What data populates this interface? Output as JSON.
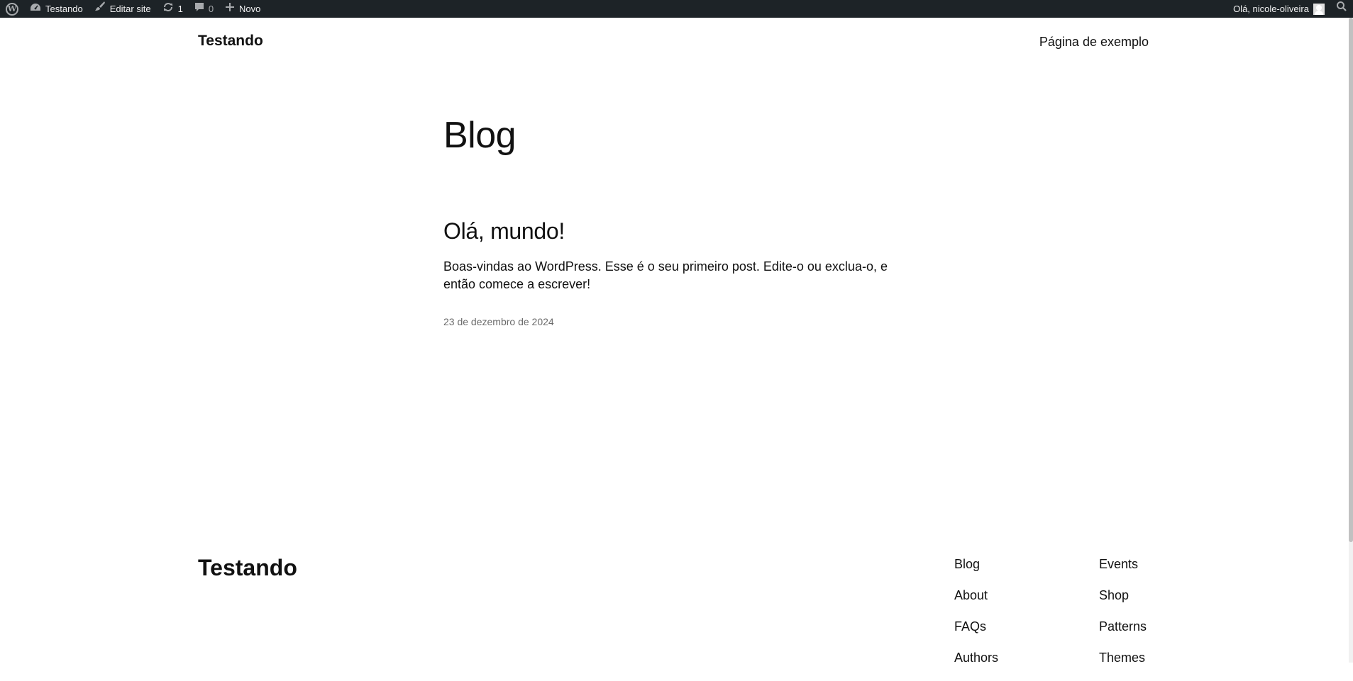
{
  "admin_bar": {
    "site_name": "Testando",
    "edit_site": "Editar site",
    "updates_count": "1",
    "comments_count": "0",
    "new_label": "Novo",
    "greeting": "Olá, nicole-oliveira",
    "icons": {
      "logo": "wordpress-logo-icon",
      "site": "dashboard-icon",
      "edit": "brush-icon",
      "updates": "refresh-icon",
      "comments": "comment-icon",
      "new": "plus-icon",
      "search": "search-icon"
    },
    "background": "#1d2327"
  },
  "header": {
    "site_title": "Testando",
    "nav_link": "Página de exemplo"
  },
  "main": {
    "heading": "Blog",
    "posts": [
      {
        "title": "Olá, mundo!",
        "excerpt": "Boas-vindas ao WordPress. Esse é o seu primeiro post. Edite-o ou exclua-o, e então comece a escrever!",
        "date": "23 de dezembro de 2024"
      }
    ]
  },
  "footer": {
    "site_title": "Testando",
    "columns": [
      [
        "Blog",
        "About",
        "FAQs",
        "Authors"
      ],
      [
        "Events",
        "Shop",
        "Patterns",
        "Themes"
      ]
    ]
  }
}
